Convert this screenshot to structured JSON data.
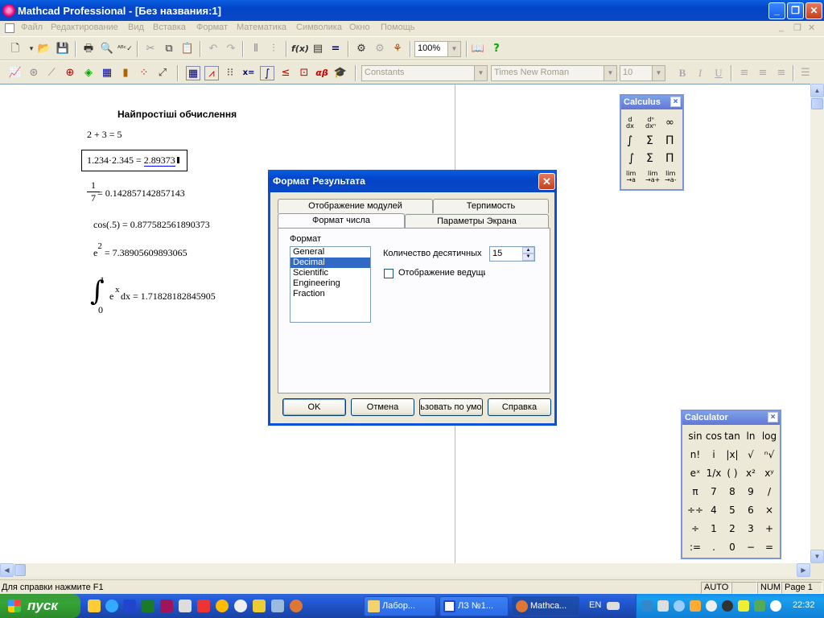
{
  "window": {
    "title": "Mathcad Professional - [Без названия:1]"
  },
  "menu": [
    "Файл",
    "Редактирование",
    "Вид",
    "Вставка",
    "Формат",
    "Математика",
    "Символика",
    "Окно",
    "Помощь"
  ],
  "toolbar": {
    "zoom": "100%"
  },
  "format_bar": {
    "style": "Constants",
    "font": "Times New Roman",
    "size": "10",
    "bold": "B",
    "italic": "I",
    "underline": "U"
  },
  "doc": {
    "heading": "Найпростіші обчислення",
    "eq1": "2 + 3 = 5",
    "eq2_lhs": "1.234·2.345 = ",
    "eq2_rhs": "2.89373",
    "eq3_num": "1",
    "eq3_den": "7",
    "eq3_rhs": "= 0.142857142857143",
    "eq4": "cos(.5) = 0.877582561890373",
    "eq5_base": "e",
    "eq5_exp": "2",
    "eq5_rhs": "= 7.38905609893065",
    "eq6_upper": "1",
    "eq6_lower": "0",
    "eq6_body": "e",
    "eq6_exp": "x",
    "eq6_rhs": "dx = 1.71828182845905"
  },
  "calculus": {
    "title": "Calculus",
    "close": "×"
  },
  "calculator": {
    "title": "Calculator",
    "close": "×",
    "rows": [
      [
        "sin",
        "cos",
        "tan",
        "ln",
        "log"
      ],
      [
        "n!",
        "i",
        "|x|",
        "√",
        "ⁿ√"
      ],
      [
        "eˣ",
        "1/x",
        "( )",
        "x²",
        "xʸ"
      ],
      [
        "π",
        "7",
        "8",
        "9",
        "/"
      ],
      [
        "÷÷",
        "4",
        "5",
        "6",
        "×"
      ],
      [
        "÷",
        "1",
        "2",
        "3",
        "+"
      ],
      [
        ":=",
        ".",
        "0",
        "−",
        "="
      ]
    ]
  },
  "dialog": {
    "title": "Формат Результата",
    "tabs": {
      "modules": "Отображение модулей",
      "tolerance": "Терпимость",
      "number": "Формат числа",
      "screen": "Параметры Экрана"
    },
    "format_label": "Формат",
    "formats": [
      "General",
      "Decimal",
      "Scientific",
      "Engineering",
      "Fraction"
    ],
    "selected_format": "Decimal",
    "decimals_label": "Количество десятичных",
    "decimals_value": "15",
    "leading_label": "Отображение ведущи",
    "buttons": {
      "ok": "OK",
      "cancel": "Отмена",
      "default": "ьзовать по умо",
      "help": "Справка"
    }
  },
  "status": {
    "hint": "Для справки нажмите F1",
    "auto": "AUTO",
    "num": "NUM",
    "page": "Page 1"
  },
  "taskbar": {
    "start": "пуск",
    "tasks": [
      "Лабор...",
      "ЛЗ №1...",
      "Mathca..."
    ],
    "lang": "EN",
    "clock": "22:32"
  }
}
